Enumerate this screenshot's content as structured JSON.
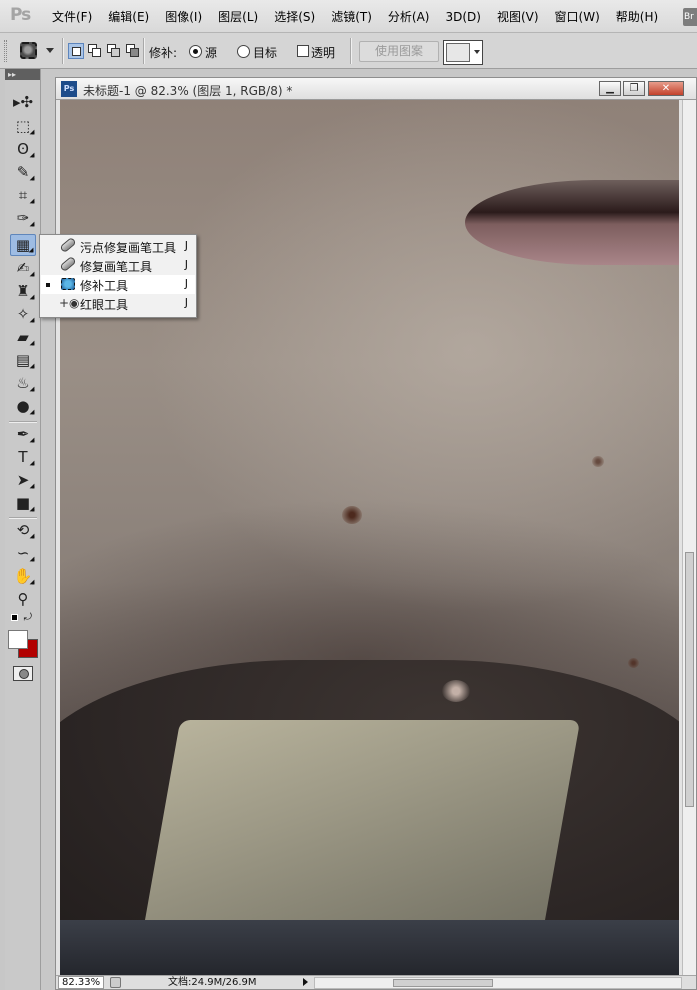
{
  "app": {
    "logo": "Ps",
    "badge": "Br"
  },
  "menu": [
    "文件(F)",
    "编辑(E)",
    "图像(I)",
    "图层(L)",
    "选择(S)",
    "滤镜(T)",
    "分析(A)",
    "3D(D)",
    "视图(V)",
    "窗口(W)",
    "帮助(H)"
  ],
  "options": {
    "patch_label": "修补:",
    "source_label": "源",
    "target_label": "目标",
    "transparent_label": "透明",
    "use_pattern_label": "使用图案",
    "source_selected": true,
    "transparent_checked": false
  },
  "toolbox": {
    "header": "▸▸",
    "tools": [
      {
        "name": "move-tool",
        "glyph": "▸✣"
      },
      {
        "name": "marquee-tool",
        "glyph": "⬚"
      },
      {
        "name": "lasso-tool",
        "glyph": "ʘ"
      },
      {
        "name": "quick-select-tool",
        "glyph": "✎"
      },
      {
        "name": "crop-tool",
        "glyph": "⌗"
      },
      {
        "name": "eyedropper-tool",
        "glyph": "✑"
      },
      {
        "name": "patch-tool",
        "glyph": "▦"
      },
      {
        "name": "brush-tool",
        "glyph": "✍"
      },
      {
        "name": "stamp-tool",
        "glyph": "♜"
      },
      {
        "name": "history-brush-tool",
        "glyph": "✧"
      },
      {
        "name": "eraser-tool",
        "glyph": "▰"
      },
      {
        "name": "gradient-tool",
        "glyph": "▤"
      },
      {
        "name": "blur-tool",
        "glyph": "♨"
      },
      {
        "name": "dodge-tool",
        "glyph": "●"
      },
      {
        "name": "pen-tool",
        "glyph": "✒"
      },
      {
        "name": "type-tool",
        "glyph": "T"
      },
      {
        "name": "path-select-tool",
        "glyph": "➤"
      },
      {
        "name": "shape-tool",
        "glyph": "■"
      },
      {
        "name": "3d-rotate-tool",
        "glyph": "⟲"
      },
      {
        "name": "3d-orbit-tool",
        "glyph": "∽"
      },
      {
        "name": "hand-tool",
        "glyph": "✋"
      },
      {
        "name": "zoom-tool",
        "glyph": "⚲"
      }
    ],
    "fg_color": "#ffffff",
    "bg_color": "#b20000"
  },
  "document": {
    "title": "未标题-1 @ 82.3% (图层 1, RGB/8) *",
    "icon": "Ps",
    "zoom": "82.33%",
    "doc_size": "文档:24.9M/26.9M",
    "minimize": "▁",
    "restore": "❐",
    "close": "✕"
  },
  "flyout": {
    "items": [
      {
        "label": "污点修复画笔工具",
        "key": "J",
        "selected": false
      },
      {
        "label": "修复画笔工具",
        "key": "J",
        "selected": false
      },
      {
        "label": "修补工具",
        "key": "J",
        "selected": true
      },
      {
        "label": "红眼工具",
        "key": "J",
        "selected": false
      }
    ]
  }
}
